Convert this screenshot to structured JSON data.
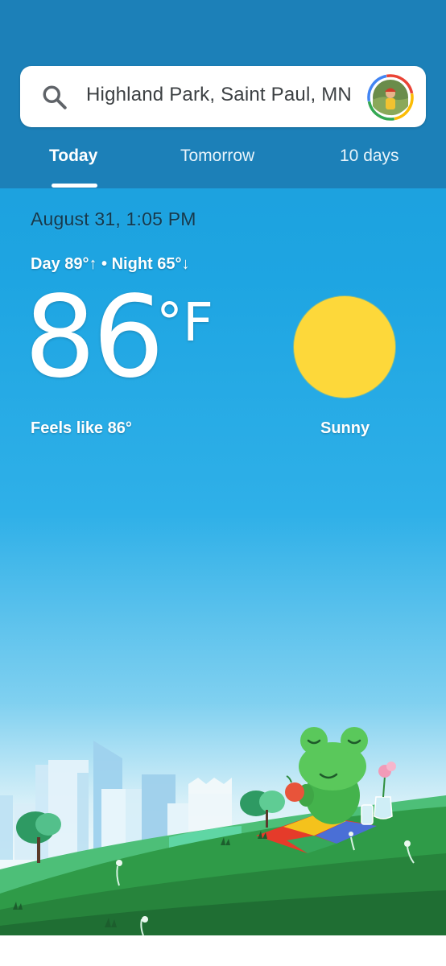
{
  "search": {
    "location": "Highland Park, Saint Paul, MN",
    "icon": "search-icon"
  },
  "tabs": [
    {
      "label": "Today",
      "active": true
    },
    {
      "label": "Tomorrow",
      "active": false
    },
    {
      "label": "10 days",
      "active": false
    }
  ],
  "weather": {
    "datetime": "August 31, 1:05 PM",
    "day_night": "Day 89°↑ • Night 65°↓",
    "temperature": "86",
    "unit": "°F",
    "feels_like": "Feels like 86°",
    "condition": "Sunny",
    "condition_icon": "sun-icon"
  },
  "colors": {
    "header": "#1c80b8",
    "sky_top": "#1a9bd8",
    "sun": "#fdd83a",
    "hill": "#2e8b3e"
  }
}
